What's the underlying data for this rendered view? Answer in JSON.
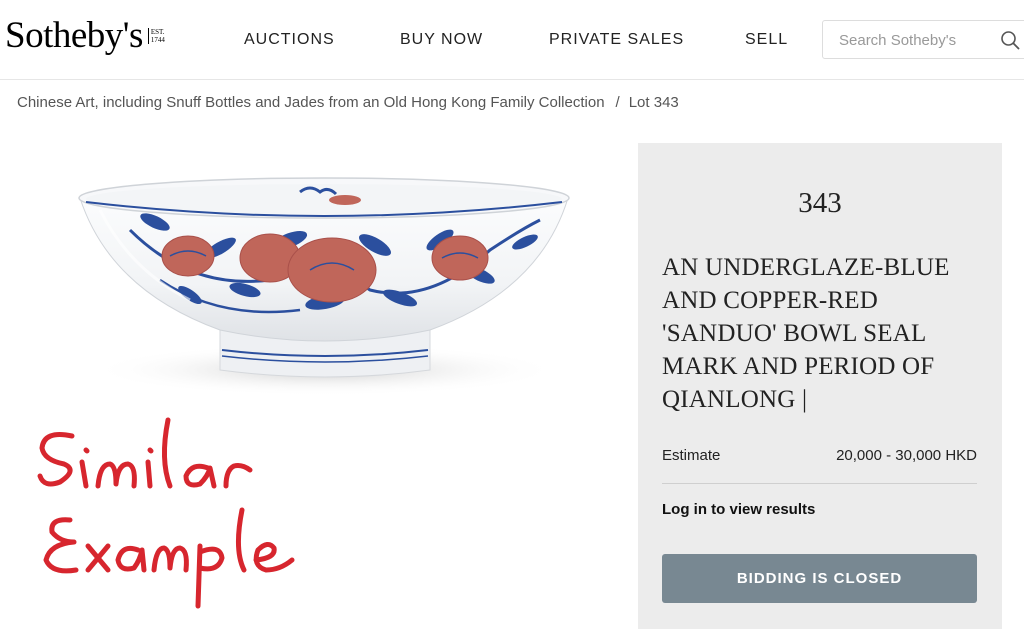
{
  "header": {
    "logo_text": "Sotheby's",
    "logo_est_line1": "EST.",
    "logo_est_line2": "1744",
    "nav": [
      {
        "label": "AUCTIONS"
      },
      {
        "label": "BUY NOW"
      },
      {
        "label": "PRIVATE SALES"
      },
      {
        "label": "SELL"
      }
    ],
    "search": {
      "placeholder": "Search Sotheby's",
      "value": "",
      "icon": "search-icon"
    }
  },
  "breadcrumb": {
    "parent": "Chinese Art, including Snuff Bottles and Jades from an Old Hong Kong Family Collection",
    "separator": "/",
    "current": "Lot 343"
  },
  "image": {
    "subject": "underglaze-blue and copper-red bowl",
    "handwriting_line1": "Similar",
    "handwriting_line2": "Example",
    "handwriting_color": "#d7262e"
  },
  "lot": {
    "number": "343",
    "title": "AN UNDERGLAZE-BLUE AND COPPER-RED 'SANDUO' BOWL SEAL MARK AND PERIOD OF QIANLONG |",
    "estimate_label": "Estimate",
    "estimate_value": "20,000 - 30,000 HKD",
    "login_text": "Log in to view results",
    "bidding_status": "BIDDING IS CLOSED"
  },
  "colors": {
    "panel_bg": "#ececec",
    "button_bg": "#788892",
    "cobalt_blue": "#2b4f9e",
    "copper_red": "#c0665a"
  }
}
